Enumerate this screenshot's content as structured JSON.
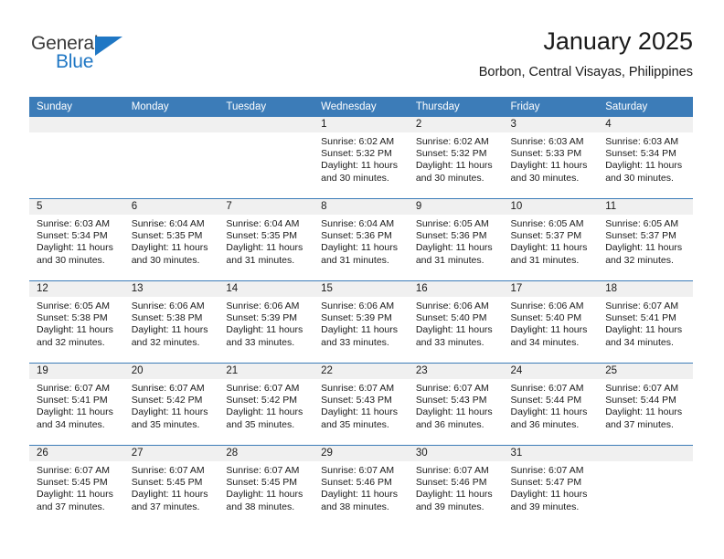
{
  "brand": {
    "name_part1": "General",
    "name_part2": "Blue",
    "accent_color": "#1f77c4"
  },
  "header": {
    "title": "January 2025",
    "subtitle": "Borbon, Central Visayas, Philippines"
  },
  "calendar": {
    "header_color": "#3c7cb8",
    "daynum_band_color": "#f0f0f0",
    "weekday_labels": [
      "Sunday",
      "Monday",
      "Tuesday",
      "Wednesday",
      "Thursday",
      "Friday",
      "Saturday"
    ],
    "weeks": [
      [
        {
          "day": "",
          "empty": true
        },
        {
          "day": "",
          "empty": true
        },
        {
          "day": "",
          "empty": true
        },
        {
          "day": "1",
          "sunrise": "Sunrise: 6:02 AM",
          "sunset": "Sunset: 5:32 PM",
          "daylight_line1": "Daylight: 11 hours",
          "daylight_line2": "and 30 minutes."
        },
        {
          "day": "2",
          "sunrise": "Sunrise: 6:02 AM",
          "sunset": "Sunset: 5:32 PM",
          "daylight_line1": "Daylight: 11 hours",
          "daylight_line2": "and 30 minutes."
        },
        {
          "day": "3",
          "sunrise": "Sunrise: 6:03 AM",
          "sunset": "Sunset: 5:33 PM",
          "daylight_line1": "Daylight: 11 hours",
          "daylight_line2": "and 30 minutes."
        },
        {
          "day": "4",
          "sunrise": "Sunrise: 6:03 AM",
          "sunset": "Sunset: 5:34 PM",
          "daylight_line1": "Daylight: 11 hours",
          "daylight_line2": "and 30 minutes."
        }
      ],
      [
        {
          "day": "5",
          "sunrise": "Sunrise: 6:03 AM",
          "sunset": "Sunset: 5:34 PM",
          "daylight_line1": "Daylight: 11 hours",
          "daylight_line2": "and 30 minutes."
        },
        {
          "day": "6",
          "sunrise": "Sunrise: 6:04 AM",
          "sunset": "Sunset: 5:35 PM",
          "daylight_line1": "Daylight: 11 hours",
          "daylight_line2": "and 30 minutes."
        },
        {
          "day": "7",
          "sunrise": "Sunrise: 6:04 AM",
          "sunset": "Sunset: 5:35 PM",
          "daylight_line1": "Daylight: 11 hours",
          "daylight_line2": "and 31 minutes."
        },
        {
          "day": "8",
          "sunrise": "Sunrise: 6:04 AM",
          "sunset": "Sunset: 5:36 PM",
          "daylight_line1": "Daylight: 11 hours",
          "daylight_line2": "and 31 minutes."
        },
        {
          "day": "9",
          "sunrise": "Sunrise: 6:05 AM",
          "sunset": "Sunset: 5:36 PM",
          "daylight_line1": "Daylight: 11 hours",
          "daylight_line2": "and 31 minutes."
        },
        {
          "day": "10",
          "sunrise": "Sunrise: 6:05 AM",
          "sunset": "Sunset: 5:37 PM",
          "daylight_line1": "Daylight: 11 hours",
          "daylight_line2": "and 31 minutes."
        },
        {
          "day": "11",
          "sunrise": "Sunrise: 6:05 AM",
          "sunset": "Sunset: 5:37 PM",
          "daylight_line1": "Daylight: 11 hours",
          "daylight_line2": "and 32 minutes."
        }
      ],
      [
        {
          "day": "12",
          "sunrise": "Sunrise: 6:05 AM",
          "sunset": "Sunset: 5:38 PM",
          "daylight_line1": "Daylight: 11 hours",
          "daylight_line2": "and 32 minutes."
        },
        {
          "day": "13",
          "sunrise": "Sunrise: 6:06 AM",
          "sunset": "Sunset: 5:38 PM",
          "daylight_line1": "Daylight: 11 hours",
          "daylight_line2": "and 32 minutes."
        },
        {
          "day": "14",
          "sunrise": "Sunrise: 6:06 AM",
          "sunset": "Sunset: 5:39 PM",
          "daylight_line1": "Daylight: 11 hours",
          "daylight_line2": "and 33 minutes."
        },
        {
          "day": "15",
          "sunrise": "Sunrise: 6:06 AM",
          "sunset": "Sunset: 5:39 PM",
          "daylight_line1": "Daylight: 11 hours",
          "daylight_line2": "and 33 minutes."
        },
        {
          "day": "16",
          "sunrise": "Sunrise: 6:06 AM",
          "sunset": "Sunset: 5:40 PM",
          "daylight_line1": "Daylight: 11 hours",
          "daylight_line2": "and 33 minutes."
        },
        {
          "day": "17",
          "sunrise": "Sunrise: 6:06 AM",
          "sunset": "Sunset: 5:40 PM",
          "daylight_line1": "Daylight: 11 hours",
          "daylight_line2": "and 34 minutes."
        },
        {
          "day": "18",
          "sunrise": "Sunrise: 6:07 AM",
          "sunset": "Sunset: 5:41 PM",
          "daylight_line1": "Daylight: 11 hours",
          "daylight_line2": "and 34 minutes."
        }
      ],
      [
        {
          "day": "19",
          "sunrise": "Sunrise: 6:07 AM",
          "sunset": "Sunset: 5:41 PM",
          "daylight_line1": "Daylight: 11 hours",
          "daylight_line2": "and 34 minutes."
        },
        {
          "day": "20",
          "sunrise": "Sunrise: 6:07 AM",
          "sunset": "Sunset: 5:42 PM",
          "daylight_line1": "Daylight: 11 hours",
          "daylight_line2": "and 35 minutes."
        },
        {
          "day": "21",
          "sunrise": "Sunrise: 6:07 AM",
          "sunset": "Sunset: 5:42 PM",
          "daylight_line1": "Daylight: 11 hours",
          "daylight_line2": "and 35 minutes."
        },
        {
          "day": "22",
          "sunrise": "Sunrise: 6:07 AM",
          "sunset": "Sunset: 5:43 PM",
          "daylight_line1": "Daylight: 11 hours",
          "daylight_line2": "and 35 minutes."
        },
        {
          "day": "23",
          "sunrise": "Sunrise: 6:07 AM",
          "sunset": "Sunset: 5:43 PM",
          "daylight_line1": "Daylight: 11 hours",
          "daylight_line2": "and 36 minutes."
        },
        {
          "day": "24",
          "sunrise": "Sunrise: 6:07 AM",
          "sunset": "Sunset: 5:44 PM",
          "daylight_line1": "Daylight: 11 hours",
          "daylight_line2": "and 36 minutes."
        },
        {
          "day": "25",
          "sunrise": "Sunrise: 6:07 AM",
          "sunset": "Sunset: 5:44 PM",
          "daylight_line1": "Daylight: 11 hours",
          "daylight_line2": "and 37 minutes."
        }
      ],
      [
        {
          "day": "26",
          "sunrise": "Sunrise: 6:07 AM",
          "sunset": "Sunset: 5:45 PM",
          "daylight_line1": "Daylight: 11 hours",
          "daylight_line2": "and 37 minutes."
        },
        {
          "day": "27",
          "sunrise": "Sunrise: 6:07 AM",
          "sunset": "Sunset: 5:45 PM",
          "daylight_line1": "Daylight: 11 hours",
          "daylight_line2": "and 37 minutes."
        },
        {
          "day": "28",
          "sunrise": "Sunrise: 6:07 AM",
          "sunset": "Sunset: 5:45 PM",
          "daylight_line1": "Daylight: 11 hours",
          "daylight_line2": "and 38 minutes."
        },
        {
          "day": "29",
          "sunrise": "Sunrise: 6:07 AM",
          "sunset": "Sunset: 5:46 PM",
          "daylight_line1": "Daylight: 11 hours",
          "daylight_line2": "and 38 minutes."
        },
        {
          "day": "30",
          "sunrise": "Sunrise: 6:07 AM",
          "sunset": "Sunset: 5:46 PM",
          "daylight_line1": "Daylight: 11 hours",
          "daylight_line2": "and 39 minutes."
        },
        {
          "day": "31",
          "sunrise": "Sunrise: 6:07 AM",
          "sunset": "Sunset: 5:47 PM",
          "daylight_line1": "Daylight: 11 hours",
          "daylight_line2": "and 39 minutes."
        },
        {
          "day": "",
          "empty": true
        }
      ]
    ]
  }
}
